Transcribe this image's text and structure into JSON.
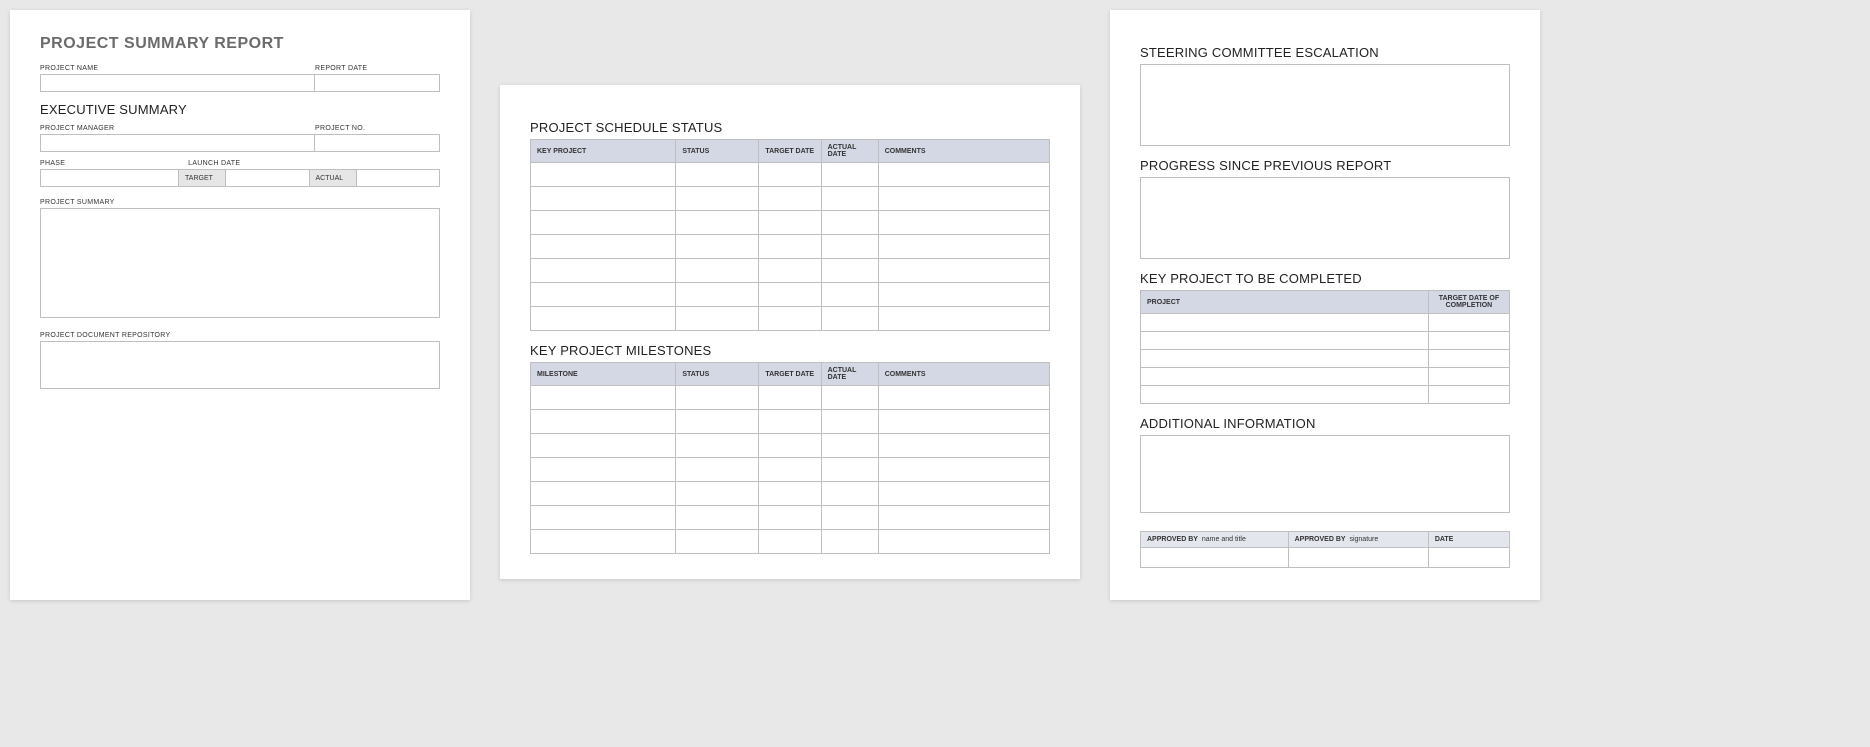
{
  "page1": {
    "title": "PROJECT SUMMARY REPORT",
    "project_name_label": "PROJECT NAME",
    "report_date_label": "REPORT DATE",
    "exec_summary_title": "EXECUTIVE SUMMARY",
    "project_manager_label": "PROJECT MANAGER",
    "project_no_label": "PROJECT NO.",
    "phase_label": "PHASE",
    "launch_date_label": "LAUNCH DATE",
    "target_label": "TARGET",
    "actual_label": "ACTUAL",
    "project_summary_label": "PROJECT SUMMARY",
    "repository_label": "PROJECT DOCUMENT REPOSITORY"
  },
  "page2": {
    "schedule_title": "PROJECT SCHEDULE STATUS",
    "schedule_headers": {
      "key_project": "KEY PROJECT",
      "status": "STATUS",
      "target_date": "TARGET DATE",
      "actual_date": "ACTUAL DATE",
      "comments": "COMMENTS"
    },
    "schedule_rows": 7,
    "milestones_title": "KEY PROJECT MILESTONES",
    "milestone_headers": {
      "milestone": "MILESTONE",
      "status": "STATUS",
      "target_date": "TARGET DATE",
      "actual_date": "ACTUAL DATE",
      "comments": "COMMENTS"
    },
    "milestone_rows": 7
  },
  "page3": {
    "steering_title": "STEERING COMMITTEE ESCALATION",
    "progress_title": "PROGRESS SINCE PREVIOUS REPORT",
    "key_project_title": "KEY PROJECT TO BE COMPLETED",
    "kp_headers": {
      "project": "PROJECT",
      "target_date": "TARGET DATE OF COMPLETION"
    },
    "kp_rows": 5,
    "additional_title": "ADDITIONAL INFORMATION",
    "approval": {
      "by_label": "APPROVED BY",
      "name_hint": "name and title",
      "sig_hint": "signature",
      "date_label": "DATE"
    }
  }
}
